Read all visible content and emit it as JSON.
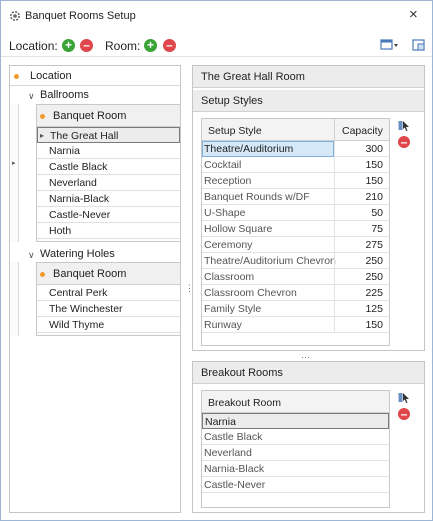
{
  "window": {
    "title": "Banquet Rooms Setup",
    "close_glyph": "×"
  },
  "toolbar": {
    "location_label": "Location:",
    "room_label": "Room:",
    "add_glyph": "+",
    "remove_glyph": "–"
  },
  "left": {
    "location_header": "Location",
    "groups": [
      {
        "name": "Ballrooms",
        "column": "Banquet Room",
        "rooms": [
          "The Great Hall",
          "Narnia",
          "Castle Black",
          "Neverland",
          "Narnia-Black",
          "Castle-Never",
          "Hoth"
        ],
        "selected": "The Great Hall"
      },
      {
        "name": "Watering Holes",
        "column": "Banquet Room",
        "rooms": [
          "Central Perk",
          "The Winchester",
          "Wild Thyme"
        ]
      }
    ]
  },
  "right": {
    "room_title": "The Great Hall Room",
    "setup_section": "Setup Styles",
    "setup_columns": [
      "Setup Style",
      "Capacity"
    ],
    "setup_rows": [
      {
        "style": "Theatre/Auditorium",
        "capacity": "300"
      },
      {
        "style": "Cocktail",
        "capacity": "150"
      },
      {
        "style": "Reception",
        "capacity": "150"
      },
      {
        "style": "Banquet Rounds w/DF",
        "capacity": "210"
      },
      {
        "style": "U-Shape",
        "capacity": "50"
      },
      {
        "style": "Hollow Square",
        "capacity": "75"
      },
      {
        "style": "Ceremony",
        "capacity": "275"
      },
      {
        "style": "Theatre/Auditorium Chevron",
        "capacity": "250"
      },
      {
        "style": "Classroom",
        "capacity": "250"
      },
      {
        "style": "Classroom Chevron",
        "capacity": "225"
      },
      {
        "style": "Family Style",
        "capacity": "125"
      },
      {
        "style": "Runway",
        "capacity": "150"
      }
    ],
    "breakout_section": "Breakout Rooms",
    "breakout_column": "Breakout Room",
    "breakout_rows": [
      "Narnia",
      "Castle Black",
      "Neverland",
      "Narnia-Black",
      "Castle-Never"
    ]
  },
  "colors": {
    "add": "#3aa336",
    "remove": "#e0474c",
    "accent_dot": "#f29a2e",
    "selection": "#d5e8f7"
  }
}
